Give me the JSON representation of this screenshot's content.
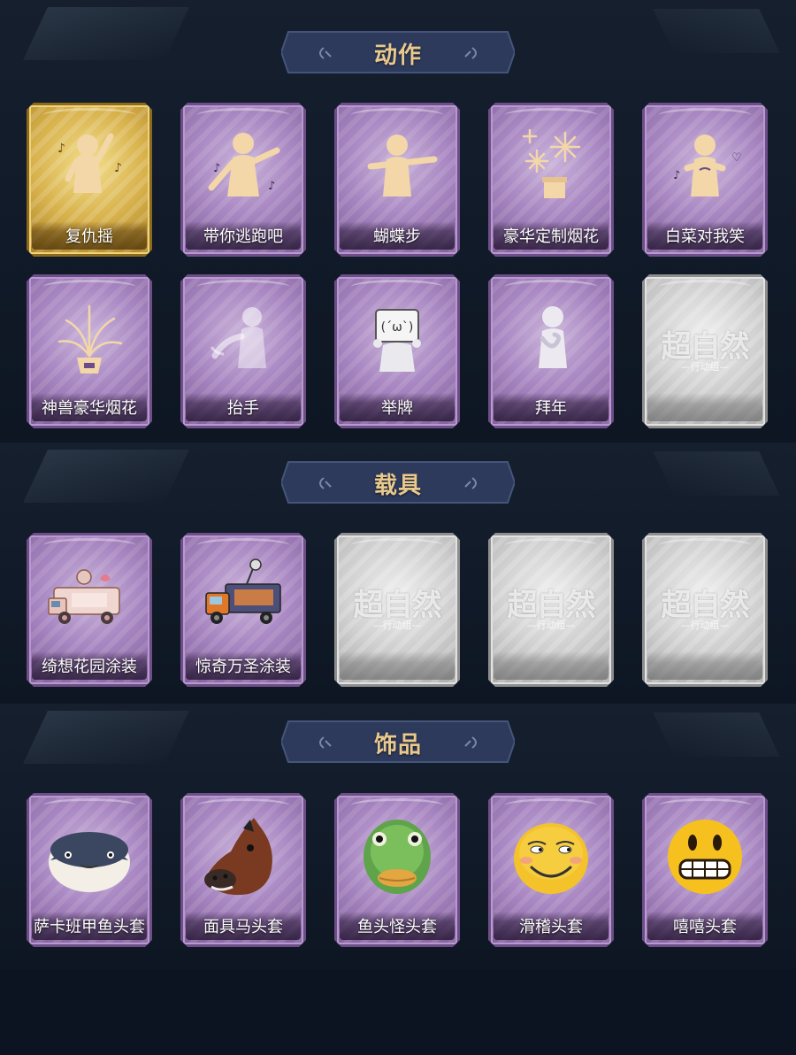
{
  "sections": [
    {
      "title": "动作",
      "items": [
        {
          "label": "复仇摇",
          "rarity": "gold",
          "icon": "dancing-figure-icon"
        },
        {
          "label": "带你逃跑吧",
          "rarity": "purple",
          "icon": "pointing-dance-figure-icon"
        },
        {
          "label": "蝴蝶步",
          "rarity": "purple",
          "icon": "arms-out-figure-icon"
        },
        {
          "label": "豪华定制烟花",
          "rarity": "purple",
          "icon": "fireworks-box-icon"
        },
        {
          "label": "白菜对我笑",
          "rarity": "purple",
          "icon": "heart-hands-figure-icon"
        },
        {
          "label": "神兽豪华烟花",
          "rarity": "purple",
          "icon": "fireworks-pot-icon"
        },
        {
          "label": "抬手",
          "rarity": "purple",
          "icon": "raised-hand-figure-icon"
        },
        {
          "label": "举牌",
          "rarity": "purple",
          "icon": "holding-sign-figure-icon"
        },
        {
          "label": "拜年",
          "rarity": "purple",
          "icon": "greeting-bow-figure-icon"
        },
        {
          "label": "",
          "rarity": "grey",
          "icon": "locked-placeholder-icon",
          "placeholder_title": "超自然",
          "placeholder_sub": "—行动组—"
        }
      ]
    },
    {
      "title": "载具",
      "items": [
        {
          "label": "绮想花园涂装",
          "rarity": "purple",
          "icon": "garden-truck-skin-icon"
        },
        {
          "label": "惊奇万圣涂装",
          "rarity": "purple",
          "icon": "halloween-truck-skin-icon"
        },
        {
          "label": "",
          "rarity": "grey",
          "icon": "locked-placeholder-icon",
          "placeholder_title": "超自然",
          "placeholder_sub": "—行动组—"
        },
        {
          "label": "",
          "rarity": "grey",
          "icon": "locked-placeholder-icon",
          "placeholder_title": "超自然",
          "placeholder_sub": "—行动组—"
        },
        {
          "label": "",
          "rarity": "grey",
          "icon": "locked-placeholder-icon",
          "placeholder_title": "超自然",
          "placeholder_sub": "—行动组—"
        }
      ]
    },
    {
      "title": "饰品",
      "items": [
        {
          "label": "萨卡班甲鱼头套",
          "rarity": "purple",
          "icon": "fish-head-mask-icon"
        },
        {
          "label": "面具马头套",
          "rarity": "purple",
          "icon": "horse-head-mask-icon"
        },
        {
          "label": "鱼头怪头套",
          "rarity": "purple",
          "icon": "green-fish-mask-icon"
        },
        {
          "label": "滑稽头套",
          "rarity": "purple",
          "icon": "smirk-emoji-mask-icon"
        },
        {
          "label": "嘻嘻头套",
          "rarity": "purple",
          "icon": "grin-emoji-mask-icon"
        }
      ]
    }
  ],
  "colors": {
    "background": "#0c1421",
    "title_text": "#e9c98e",
    "purple_card": "#a987c2",
    "gold_card": "#d8b24c",
    "grey_card": "#cfcfcf"
  }
}
